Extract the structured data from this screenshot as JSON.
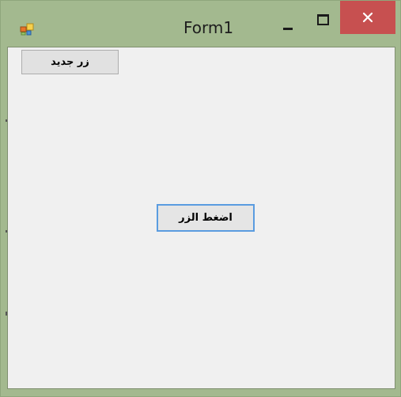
{
  "window": {
    "title": "Form1",
    "icon": "winforms-app-icon"
  },
  "title_buttons": {
    "minimize_icon": "minimize-icon",
    "maximize_icon": "maximize-icon",
    "close_icon": "close-icon",
    "close_color": "#c75050"
  },
  "form": {
    "new_button_label": "زر جديد",
    "press_button_label": "اضغط الزر"
  },
  "colors": {
    "frame": "#a3b98f",
    "client": "#f0f0f0",
    "focus_border": "#5a9ce0"
  }
}
